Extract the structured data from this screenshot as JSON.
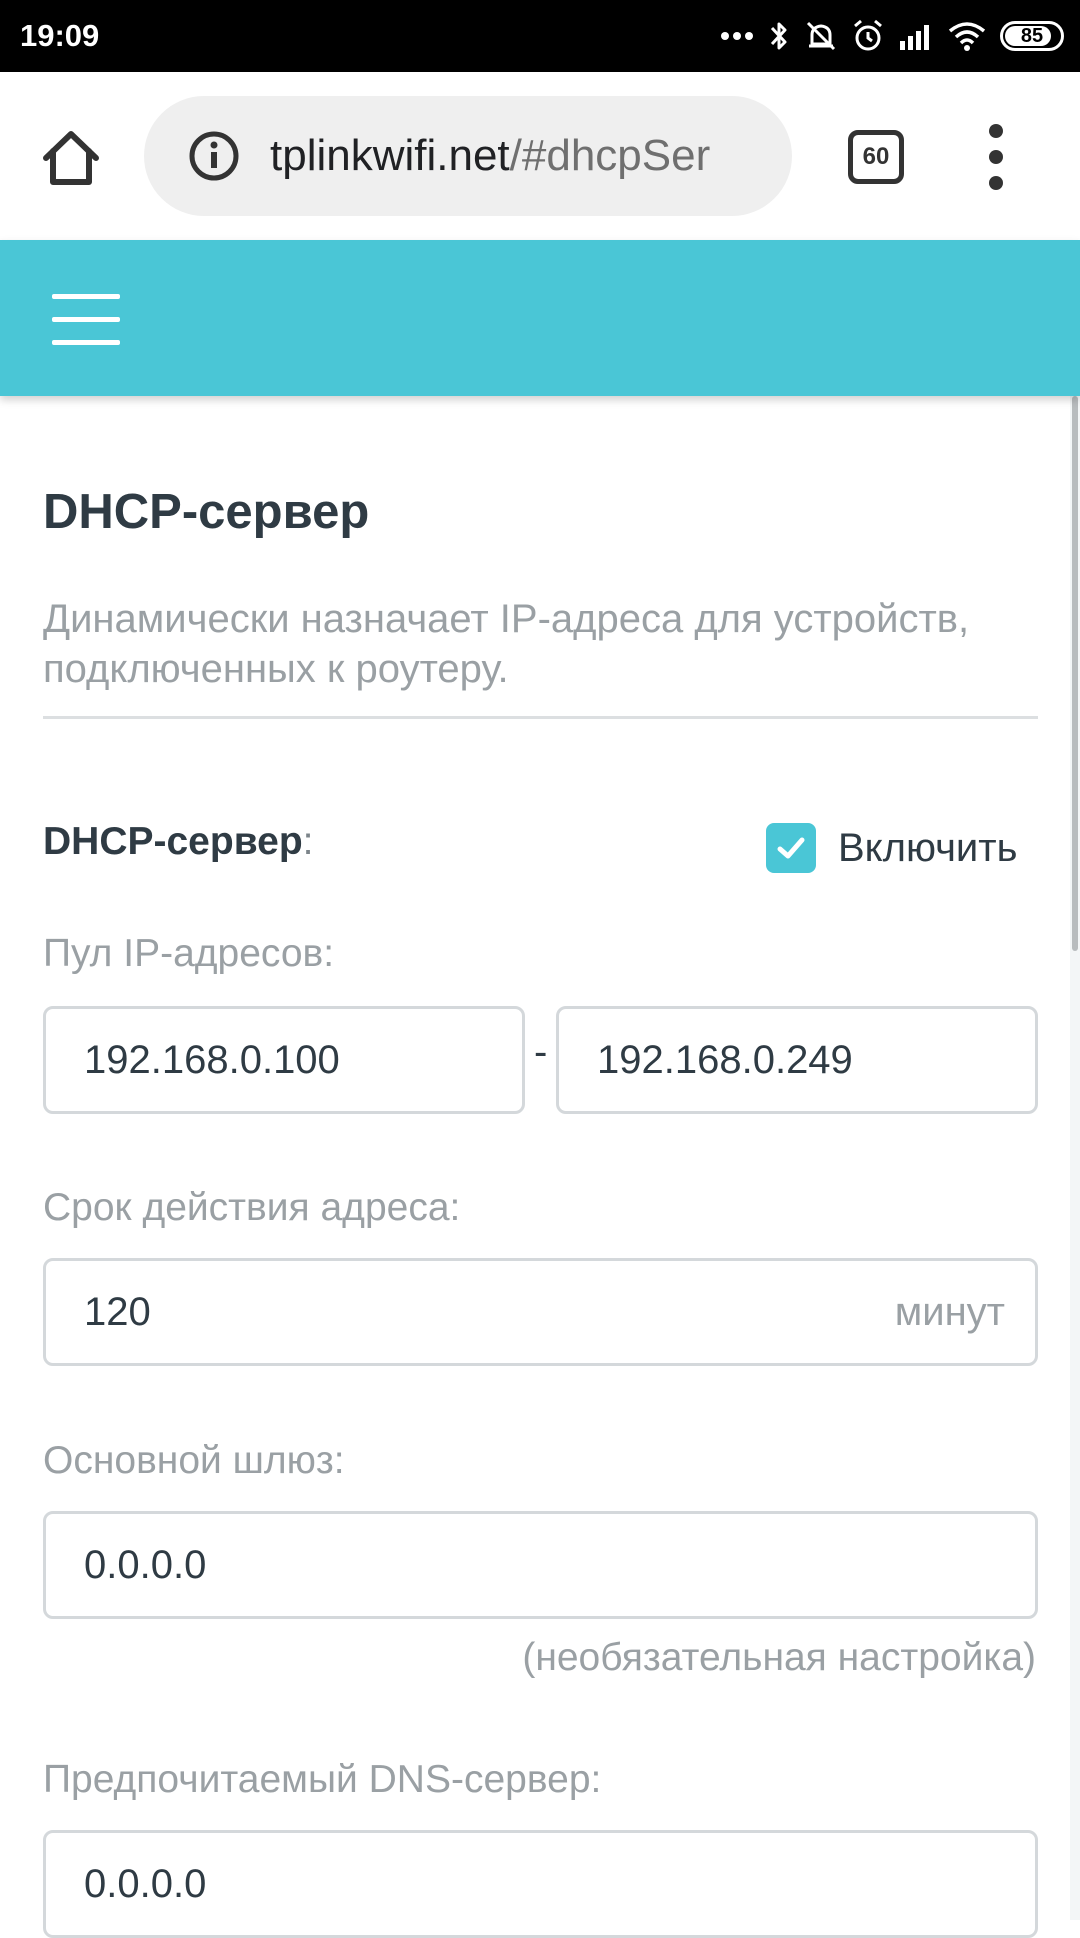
{
  "status_bar": {
    "time": "19:09",
    "battery_level": "85",
    "battery_fraction": 0.85,
    "icons": [
      "more-dots-icon",
      "bluetooth-icon",
      "silent-mode-icon",
      "alarm-icon",
      "signal-icon",
      "wifi-icon",
      "battery-icon"
    ]
  },
  "browser": {
    "url_host": "tplinkwifi.net",
    "url_path": "/#dhcpSer",
    "tab_count": "60",
    "icons": [
      "home-icon",
      "info-icon",
      "tabs-icon",
      "more-vert-icon"
    ]
  },
  "header": {
    "menu_icon": "hamburger-menu-icon",
    "color": "#4ac6d6"
  },
  "page": {
    "title": "DHCP-сервер",
    "description": "Динамически назначает IP-адреса для устройств, подключенных к роутеру."
  },
  "form": {
    "dhcp_server": {
      "label": "DHCP-сервер",
      "colon": ":",
      "checkbox_label": "Включить",
      "checked": true
    },
    "ip_pool": {
      "label": "Пул IP-адресов:",
      "start": "192.168.0.100",
      "separator": "-",
      "end": "192.168.0.249"
    },
    "lease_time": {
      "label": "Срок действия адреса:",
      "value": "120",
      "unit": "минут"
    },
    "gateway": {
      "label": "Основной шлюз:",
      "value": "0.0.0.0",
      "note": "(необязательная настройка)"
    },
    "dns_primary": {
      "label": "Предпочитаемый DNS-сервер:",
      "value": "0.0.0.0"
    }
  },
  "colors": {
    "accent": "#4ac6d6",
    "title_text": "#2f3b44",
    "muted_text": "#9aa0a4"
  }
}
